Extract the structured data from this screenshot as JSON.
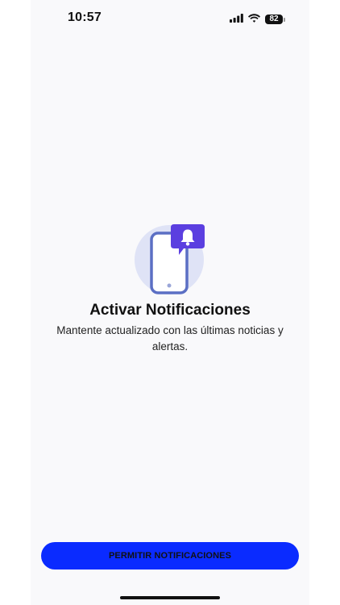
{
  "status_bar": {
    "time": "10:57",
    "battery": "82",
    "icons": [
      "signal-icon",
      "wifi-icon",
      "battery-icon"
    ]
  },
  "content": {
    "icons": [
      "phone-icon",
      "bell-icon"
    ],
    "title": "Activar Notificaciones",
    "subtitle": "Mantente actualizado con las últimas noticias y alertas."
  },
  "actions": {
    "allow_label": "PERMITIR NOTIFICACIONES"
  },
  "colors": {
    "background": "#f9f9fb",
    "primary_button": "#0a2bff",
    "bell_badge": "#5b3fe0",
    "phone_outline": "#5b6fc4",
    "circle_bg": "#dfe3f6"
  }
}
